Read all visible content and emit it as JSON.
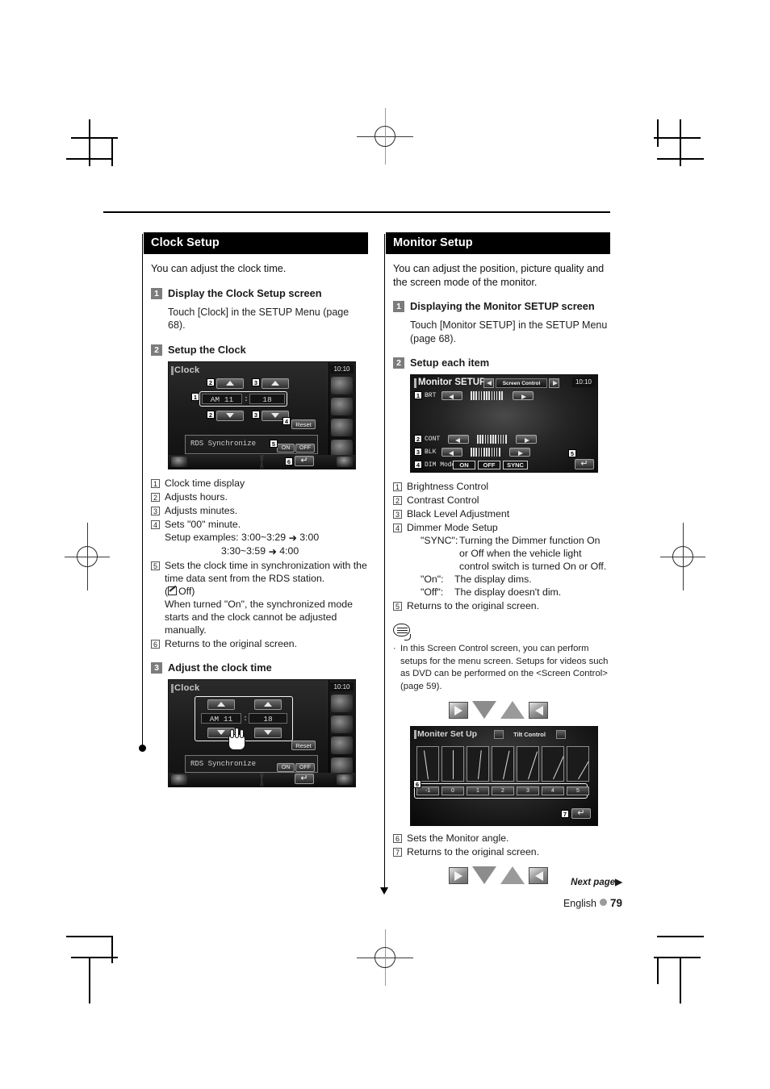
{
  "page": {
    "language": "English",
    "number": "79",
    "next_page_label": "Next page",
    "next_page_arrow": "▶"
  },
  "left_column": {
    "section_title": "Clock Setup",
    "intro": "You can adjust the clock time.",
    "steps": [
      {
        "num": "1",
        "title": "Display the Clock Setup screen",
        "body": "Touch [Clock] in the SETUP Menu (page 68)."
      },
      {
        "num": "2",
        "title": "Setup the Clock"
      },
      {
        "num": "3",
        "title": "Adjust the clock time"
      }
    ],
    "clock_screen": {
      "title": "Clock",
      "time": "10:10",
      "hour_value": "AM 11",
      "separator": ":",
      "minute_value": "18",
      "reset_label": "Reset",
      "rds_label": "RDS Synchronize",
      "rds_on": "ON",
      "rds_off": "OFF",
      "callouts": [
        "1",
        "2",
        "2",
        "3",
        "3",
        "4",
        "5",
        "6"
      ]
    },
    "callouts": [
      {
        "n": "1",
        "text": "Clock time display"
      },
      {
        "n": "2",
        "text": "Adjusts hours."
      },
      {
        "n": "3",
        "text": "Adjusts minutes."
      },
      {
        "n": "4",
        "text": "Sets \"00\" minute.",
        "sub": "Setup examples: 3:00~3:29",
        "sub_result": "3:00",
        "sub2": "3:30~3:59",
        "sub2_result": "4:00"
      },
      {
        "n": "5",
        "text": "Sets the clock time in synchronization with the time data sent from the RDS station.",
        "default_note": "Off",
        "extra": "When turned \"On\", the synchronized mode starts and the clock cannot be adjusted manually."
      },
      {
        "n": "6",
        "text": "Returns to the original screen."
      }
    ]
  },
  "right_column": {
    "section_title": "Monitor Setup",
    "intro": "You can adjust the position, picture quality and the screen mode of the monitor.",
    "steps": [
      {
        "num": "1",
        "title": "Displaying the Monitor SETUP screen",
        "body": "Touch [Monitor SETUP] in the SETUP Menu (page 68)."
      },
      {
        "num": "2",
        "title": "Setup each item"
      }
    ],
    "monitor_screen": {
      "title": "Monitor SETUP",
      "tab_label": "Screen Control",
      "time": "10:10",
      "rows": [
        {
          "n": "1",
          "label": "BRT"
        },
        {
          "n": "2",
          "label": "CONT"
        },
        {
          "n": "3",
          "label": "BLK"
        }
      ],
      "dim_label": "DIM Mode",
      "dim_buttons": [
        "ON",
        "OFF",
        "SYNC"
      ],
      "dim_callout": "4",
      "return_callout": "5"
    },
    "callouts": [
      {
        "n": "1",
        "text": "Brightness Control"
      },
      {
        "n": "2",
        "text": "Contrast Control"
      },
      {
        "n": "3",
        "text": "Black Level Adjustment"
      },
      {
        "n": "4",
        "text": "Dimmer Mode Setup",
        "defs": [
          {
            "k": "\"SYNC\":",
            "v": "Turning the Dimmer function On or Off when the vehicle light control switch is turned On or Off."
          },
          {
            "k": "\"On\":",
            "v": "The display dims."
          },
          {
            "k": "\"Off\":",
            "v": "The display doesn't dim."
          }
        ]
      },
      {
        "n": "5",
        "text": "Returns to the original screen."
      }
    ],
    "note": {
      "bullet": "·",
      "text": "In this Screen Control screen, you can perform setups for the menu screen. Setups for videos such as DVD can be performed on the <Screen Control> (page 59)."
    },
    "tilt_screen": {
      "title": "Moniter Set Up",
      "tab_label": "Tilt Control",
      "angles": [
        "-1",
        "0",
        "1",
        "2",
        "3",
        "4",
        "5"
      ],
      "select_callout": "6",
      "return_callout": "7"
    },
    "tilt_callouts": [
      {
        "n": "6",
        "text": "Sets the Monitor angle."
      },
      {
        "n": "7",
        "text": "Returns to the original screen."
      }
    ]
  },
  "nav_glyphs": [
    "play-right-icon",
    "triangle-down-icon",
    "triangle-up-icon",
    "play-left-icon"
  ]
}
